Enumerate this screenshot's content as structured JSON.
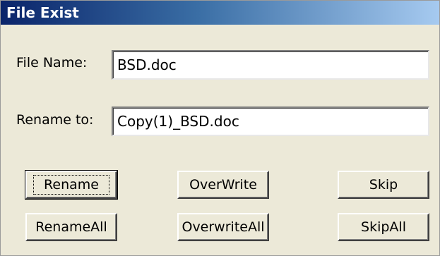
{
  "window": {
    "title": "File Exist"
  },
  "form": {
    "file_name_label": "File Name:",
    "file_name_value": "BSD.doc",
    "rename_to_label": "Rename to:",
    "rename_to_value": "Copy(1)_BSD.doc"
  },
  "buttons": {
    "rename": "Rename",
    "overwrite": "OverWrite",
    "skip": "Skip",
    "rename_all": "RenameAll",
    "overwrite_all": "OverwriteAll",
    "skip_all": "SkipAll"
  },
  "colors": {
    "title_bar_start": "#0a246a",
    "title_bar_end": "#a6caf0",
    "dialog_background": "#ece9d8"
  }
}
